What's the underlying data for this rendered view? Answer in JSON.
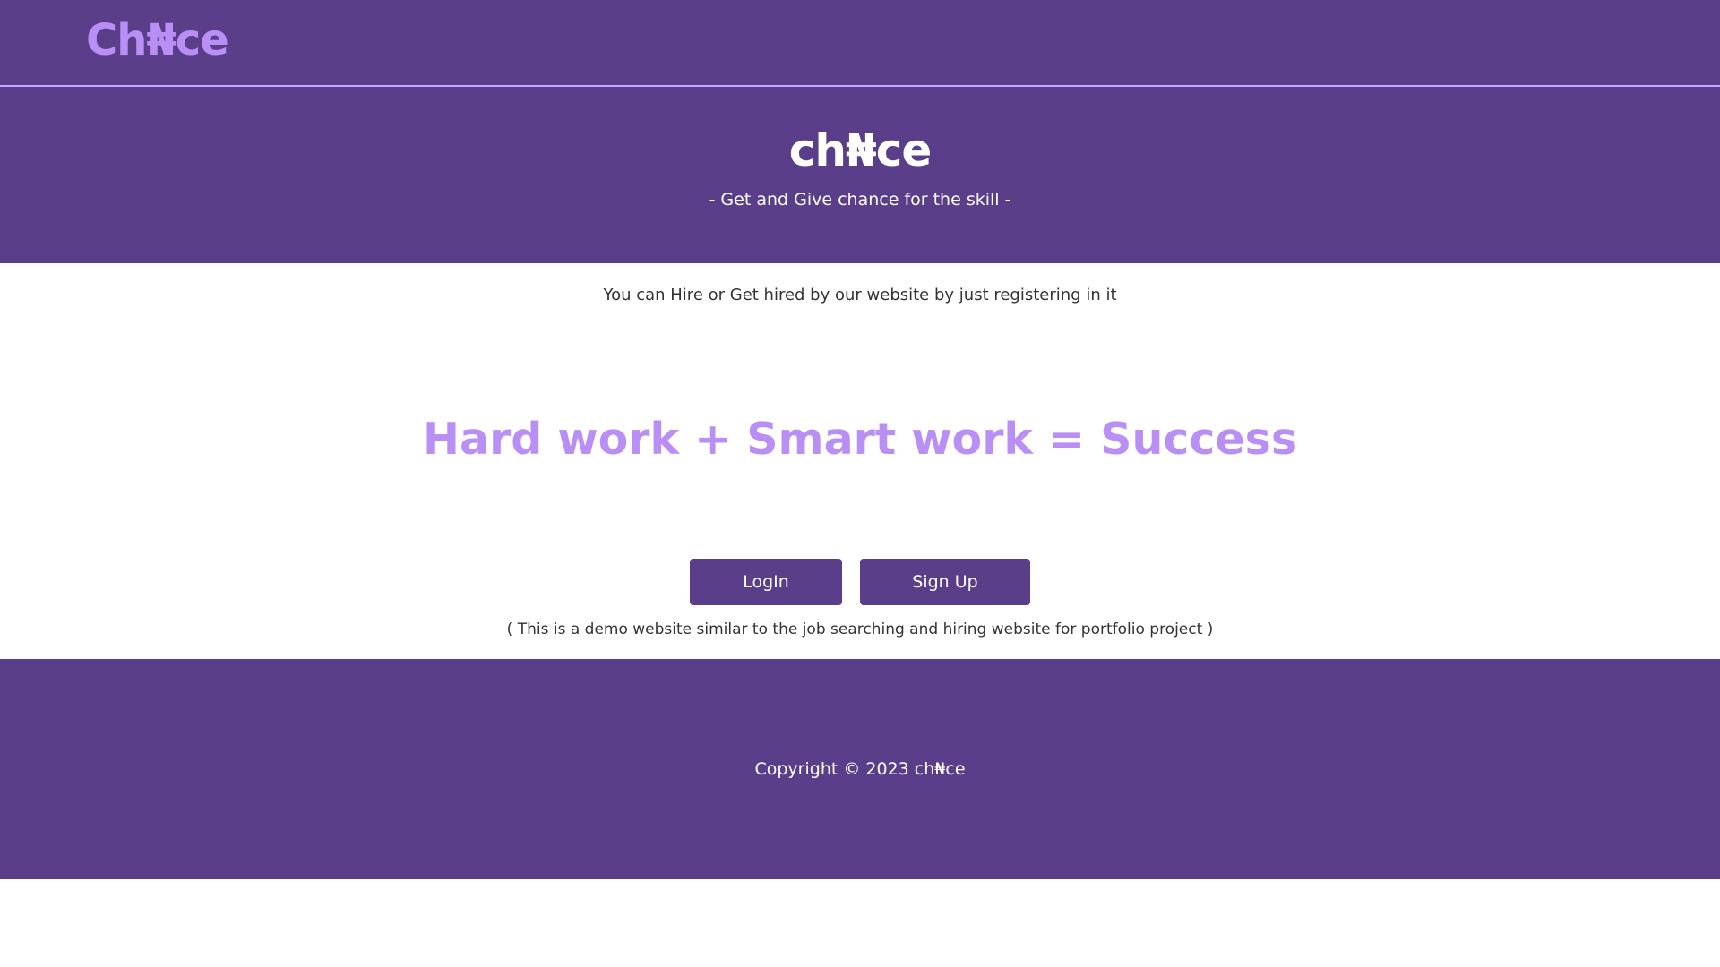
{
  "navbar": {
    "logo": "Ch₦ce"
  },
  "hero": {
    "title": "ch₦ce",
    "tagline": "- Get and Give chance for the skill -"
  },
  "main": {
    "intro": "You can Hire or Get hired by our website by just registering in it",
    "slogan": "Hard work + Smart work = Success",
    "login_label": "LogIn",
    "signup_label": "Sign Up",
    "note": "( This is a demo website similar to the job searching and hiring website for portfolio project )"
  },
  "footer": {
    "copyright": "Copyright © 2023 ch₦ce"
  },
  "colors": {
    "brand_purple": "#5a3e89",
    "accent_lilac": "#b98ef5",
    "divider": "#c8a5ff"
  }
}
